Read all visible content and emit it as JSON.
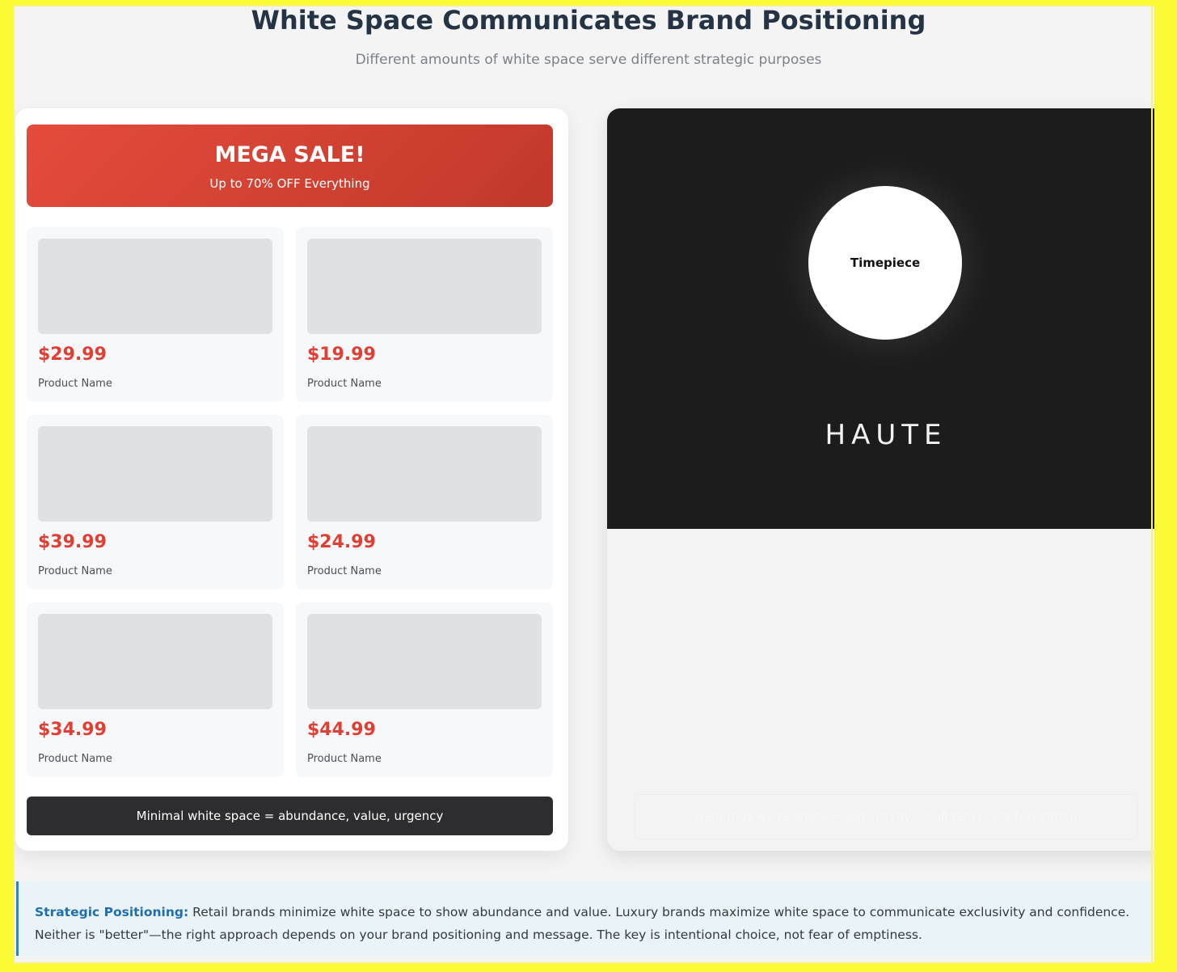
{
  "title": "White Space Communicates Brand Positioning",
  "subtitle": "Different amounts of white space serve different strategic purposes",
  "retail": {
    "banner_title": "MEGA SALE!",
    "banner_subtitle": "Up to 70% OFF Everything",
    "products": [
      {
        "price": "$29.99",
        "name": "Product Name"
      },
      {
        "price": "$19.99",
        "name": "Product Name"
      },
      {
        "price": "$39.99",
        "name": "Product Name"
      },
      {
        "price": "$24.99",
        "name": "Product Name"
      },
      {
        "price": "$34.99",
        "name": "Product Name"
      },
      {
        "price": "$44.99",
        "name": "Product Name"
      }
    ],
    "caption": "Minimal white space = abundance, value, urgency"
  },
  "luxury": {
    "product_label": "Timepiece",
    "brand": "HAUTE",
    "caption": "Generous white space = exclusivity, confidence, sophistication"
  },
  "note": {
    "label": "Strategic Positioning:",
    "text": " Retail brands minimize white space to show abundance and value. Luxury brands maximize white space to communicate exclusivity and confidence. Neither is \"better\"—the right approach depends on your brand positioning and message. The key is intentional choice, not fear of emptiness."
  },
  "colors": {
    "frame": "#fbfa35",
    "sale_red": "#e03f33",
    "dark_panel": "#1c1c1d",
    "accent_blue": "#1f6fad"
  }
}
